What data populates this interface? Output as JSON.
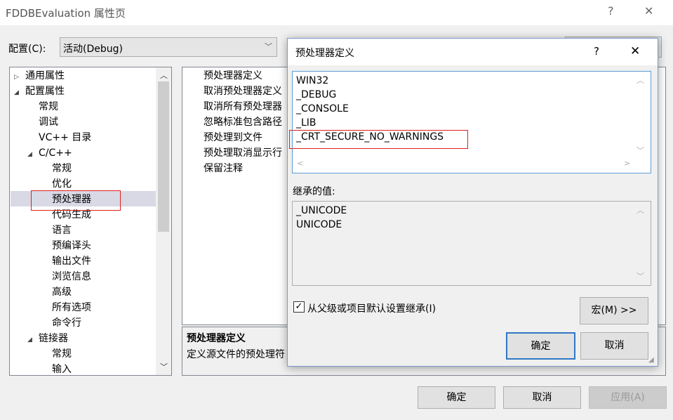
{
  "window": {
    "title": "FDDBEvaluation 属性页",
    "help": "?",
    "close": "✕"
  },
  "config": {
    "label": "配置(C):",
    "value": "活动(Debug)"
  },
  "tree": [
    {
      "label": "通用属性",
      "indent": 0,
      "arrow": "▷"
    },
    {
      "label": "配置属性",
      "indent": 0,
      "arrow": "◢"
    },
    {
      "label": "常规",
      "indent": 1
    },
    {
      "label": "调试",
      "indent": 1
    },
    {
      "label": "VC++ 目录",
      "indent": 1
    },
    {
      "label": "C/C++",
      "indent": 1,
      "arrow": "◢"
    },
    {
      "label": "常规",
      "indent": 2
    },
    {
      "label": "优化",
      "indent": 2
    },
    {
      "label": "预处理器",
      "indent": 2,
      "selected": true
    },
    {
      "label": "代码生成",
      "indent": 2
    },
    {
      "label": "语言",
      "indent": 2
    },
    {
      "label": "预编译头",
      "indent": 2
    },
    {
      "label": "输出文件",
      "indent": 2
    },
    {
      "label": "浏览信息",
      "indent": 2
    },
    {
      "label": "高级",
      "indent": 2
    },
    {
      "label": "所有选项",
      "indent": 2
    },
    {
      "label": "命令行",
      "indent": 2
    },
    {
      "label": "链接器",
      "indent": 1,
      "arrow": "◢"
    },
    {
      "label": "常规",
      "indent": 2
    },
    {
      "label": "输入",
      "indent": 2
    }
  ],
  "grid": [
    "预处理器定义",
    "取消预处理器定义",
    "取消所有预处理器",
    "忽略标准包含路径",
    "预处理到文件",
    "预处理取消显示行",
    "保留注释"
  ],
  "description": {
    "title": "预处理器定义",
    "text": "定义源文件的预处理符"
  },
  "buttons": {
    "ok": "确定",
    "cancel": "取消",
    "apply": "应用(A)"
  },
  "dialog": {
    "title": "预处理器定义",
    "help": "?",
    "close": "✕",
    "definitions": [
      "WIN32",
      "_DEBUG",
      "_CONSOLE",
      "_LIB",
      "_CRT_SECURE_NO_WARNINGS"
    ],
    "inherited_label": "继承的值:",
    "inherited": [
      "_UNICODE",
      "UNICODE"
    ],
    "inherit_checkbox": {
      "label": "从父级或项目默认设置继承(I)",
      "checked": true
    },
    "macro_button": "宏(M) >>",
    "ok": "确定",
    "cancel": "取消"
  },
  "highlight_color": "#e02020"
}
